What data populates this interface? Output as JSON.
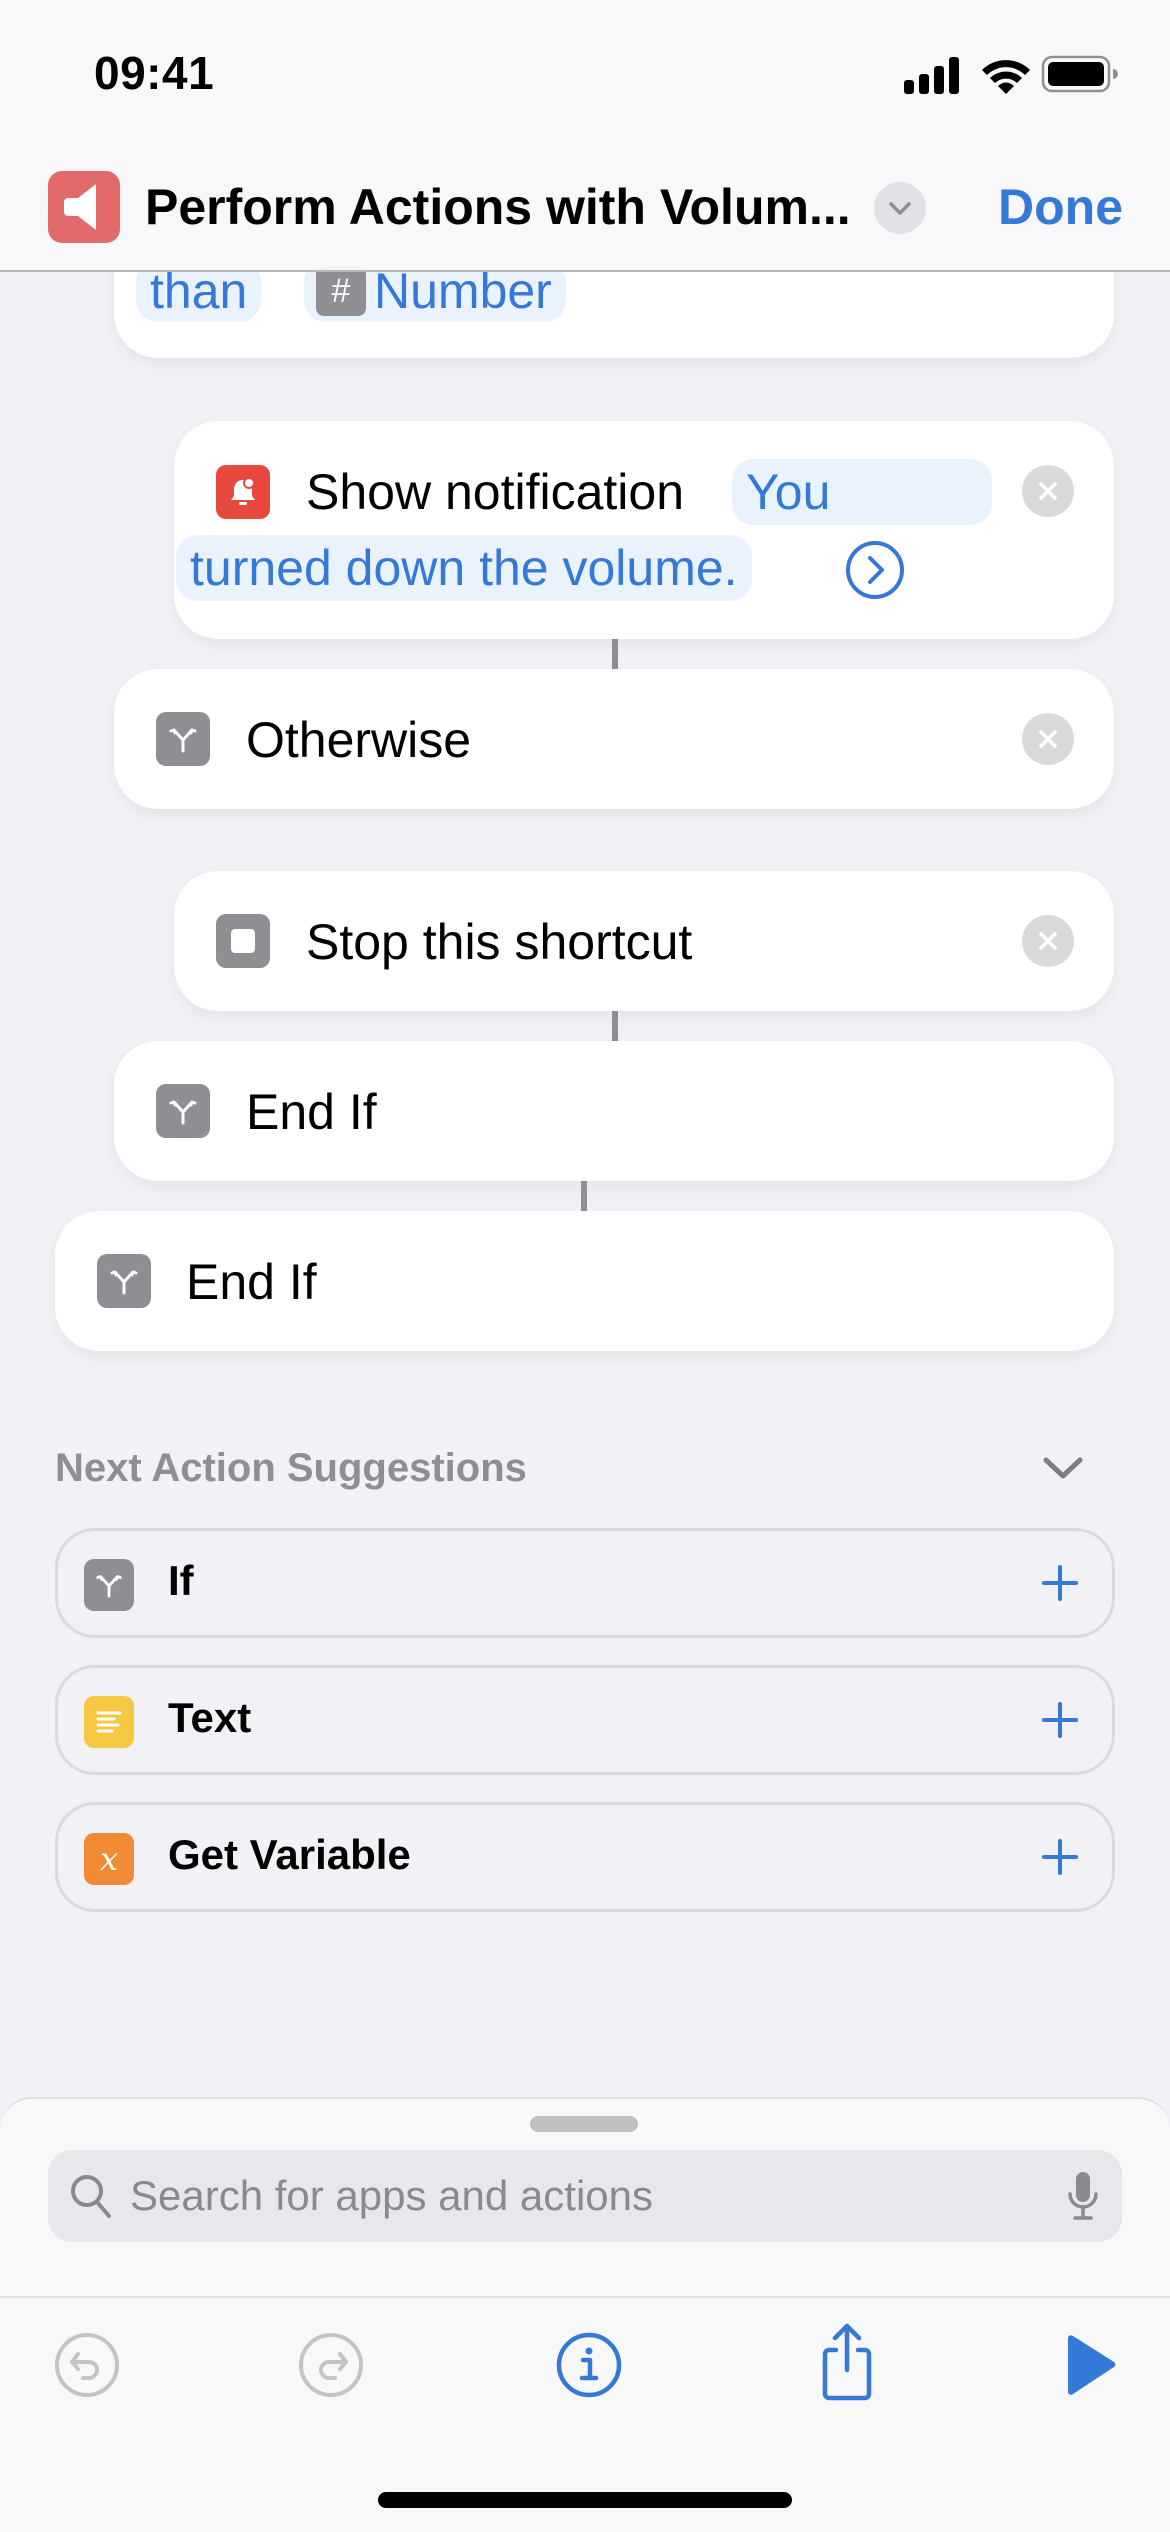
{
  "status_bar": {
    "time": "09:41",
    "icons": [
      "cellular-signal-icon",
      "wifi-icon",
      "battery-icon"
    ]
  },
  "nav": {
    "app_icon": "speaker-icon",
    "title": "Perform Actions with Volum...",
    "title_menu_icon": "chevron-down-icon",
    "done_label": "Done",
    "accent_color": "#3478d8",
    "app_icon_color": "#e26a6a"
  },
  "actions": [
    {
      "kind": "condition-fragment",
      "tokens": [
        "than",
        "Number"
      ],
      "token_icon": "number-sign-icon"
    },
    {
      "kind": "show-notification",
      "icon": "notification-bell-icon",
      "label": "Show notification",
      "param_line1": "You",
      "param_line2": "turned down the volume.",
      "expand_icon": "chevron-right-circle-icon",
      "delete_icon": "remove-icon"
    },
    {
      "kind": "otherwise",
      "icon": "branch-icon",
      "label": "Otherwise",
      "delete_icon": "remove-icon"
    },
    {
      "kind": "stop",
      "icon": "stop-icon",
      "label": "Stop this shortcut",
      "delete_icon": "remove-icon"
    },
    {
      "kind": "end-if",
      "icon": "branch-icon",
      "label": "End If"
    },
    {
      "kind": "end-if",
      "icon": "branch-icon",
      "label": "End If"
    }
  ],
  "suggestions": {
    "header": "Next Action Suggestions",
    "collapse_icon": "chevron-down-icon",
    "items": [
      {
        "label": "If",
        "icon": "branch-icon",
        "color": "#8e8e93"
      },
      {
        "label": "Text",
        "icon": "text-lines-icon",
        "color": "#f5c842"
      },
      {
        "label": "Get Variable",
        "icon": "variable-x-icon",
        "color": "#f08a35"
      }
    ],
    "add_icon": "plus-icon"
  },
  "search": {
    "placeholder": "Search for apps and actions",
    "icon": "magnifier-icon",
    "mic_icon": "microphone-icon"
  },
  "toolbar": {
    "undo": {
      "icon": "undo-icon",
      "enabled": false
    },
    "redo": {
      "icon": "redo-icon",
      "enabled": false
    },
    "info": {
      "icon": "info-icon",
      "enabled": true
    },
    "share": {
      "icon": "share-icon",
      "enabled": true
    },
    "run": {
      "icon": "play-icon",
      "enabled": true
    }
  }
}
